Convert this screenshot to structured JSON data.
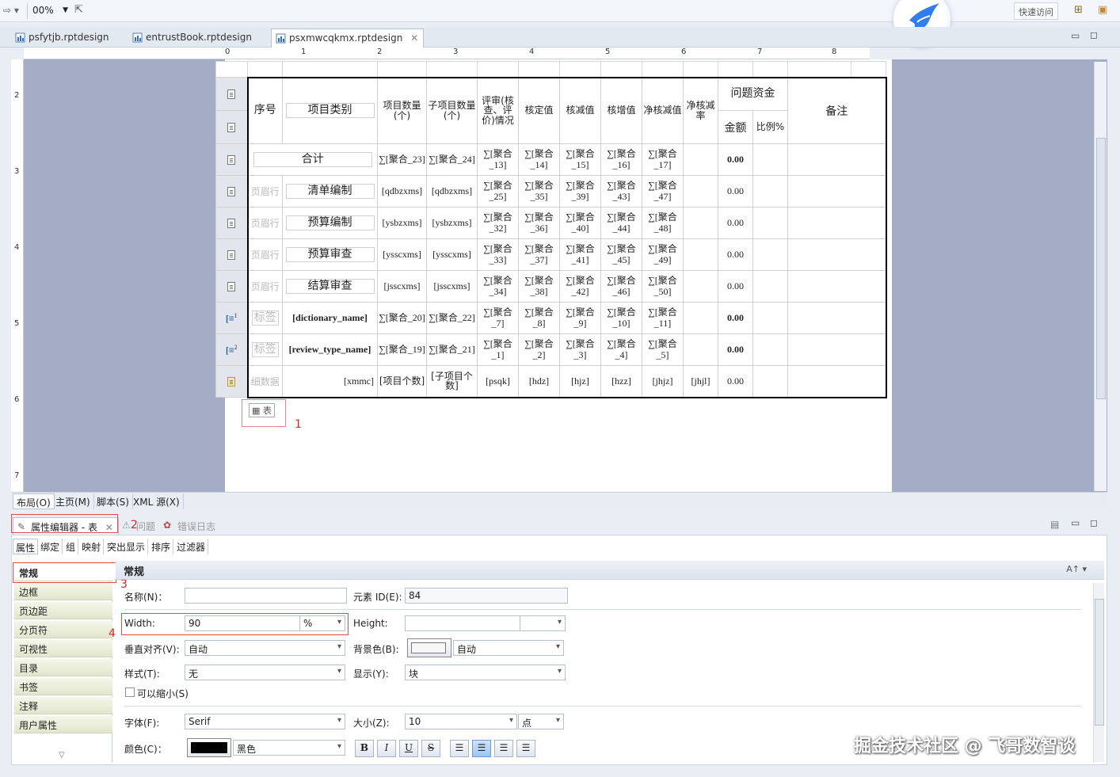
{
  "toolbar": {
    "zoom": "00%",
    "quick_access": "快速访问"
  },
  "tabs": [
    {
      "label": "psfytjb.rptdesign"
    },
    {
      "label": "entrustBook.rptdesign"
    },
    {
      "label": "psxmwcqkmx.rptdesign"
    }
  ],
  "ruler": {
    "h": [
      "0",
      "1",
      "2",
      "3",
      "4",
      "5",
      "6",
      "7",
      "8"
    ],
    "v": [
      "2",
      "3",
      "4",
      "5",
      "6",
      "7"
    ]
  },
  "report": {
    "header": {
      "xh": "序号",
      "xmlb": "项目类别",
      "xmsl": "项目数量(个)",
      "zxmsl": "子项目数量(个)",
      "psqk": "评审(核查、评价)情况",
      "hdz": "核定值",
      "hjz": "核减值",
      "hzz": "核增值",
      "jhjz": "净核减值",
      "jhjl": "净核减率",
      "wtzj": "问题资金",
      "je": "金额",
      "bl": "比例%",
      "bz": "备注"
    },
    "total": {
      "label": "合计",
      "cells": [
        "∑[聚合_23]",
        "∑[聚合_24]",
        "∑[聚合_13]",
        "∑[聚合_14]",
        "∑[聚合_15]",
        "∑[聚合_16]",
        "∑[聚合_17]"
      ],
      "amount": "0.00"
    },
    "rows": [
      {
        "ghost": "页眉行",
        "name": "清单编制",
        "a": "[qdbzxms]",
        "b": "[qdbzxms]",
        "c": [
          "∑[聚合_25]",
          "∑[聚合_35]",
          "∑[聚合_39]",
          "∑[聚合_43]",
          "∑[聚合_47]"
        ],
        "amount": "0.00"
      },
      {
        "ghost": "页眉行",
        "name": "预算编制",
        "a": "[ysbzxms]",
        "b": "[ysbzxms]",
        "c": [
          "∑[聚合_32]",
          "∑[聚合_36]",
          "∑[聚合_40]",
          "∑[聚合_44]",
          "∑[聚合_48]"
        ],
        "amount": "0.00"
      },
      {
        "ghost": "页眉行",
        "name": "预算审查",
        "a": "[ysscxms]",
        "b": "[ysscxms]",
        "c": [
          "∑[聚合_33]",
          "∑[聚合_37]",
          "∑[聚合_41]",
          "∑[聚合_45]",
          "∑[聚合_49]"
        ],
        "amount": "0.00"
      },
      {
        "ghost": "页眉行",
        "name": "结算审查",
        "a": "[jssсxms]",
        "b": "[jssсxms]",
        "c": [
          "∑[聚合_34]",
          "∑[聚合_38]",
          "∑[聚合_42]",
          "∑[聚合_46]",
          "∑[聚合_50]"
        ],
        "amount": "0.00"
      }
    ],
    "groups": [
      {
        "icon_num": "1",
        "ghost": "标签",
        "name": "[dictionary_name]",
        "a": "∑[聚合_20]",
        "b": "∑[聚合_22]",
        "c": [
          "∑[聚合_7]",
          "∑[聚合_8]",
          "∑[聚合_9]",
          "∑[聚合_10]",
          "∑[聚合_11]"
        ],
        "amount": "0.00"
      },
      {
        "icon_num": "2",
        "ghost": "标签",
        "name": "[review_type_name]",
        "a": "∑[聚合_19]",
        "b": "∑[聚合_21]",
        "c": [
          "∑[聚合_1]",
          "∑[聚合_2]",
          "∑[聚合_3]",
          "∑[聚合_4]",
          "∑[聚合_5]"
        ],
        "amount": "0.00"
      }
    ],
    "detail": {
      "ghost": "细数据",
      "name": "[xmmc]",
      "a": "[项目个数]",
      "b": "[子项目个数]",
      "c": [
        "[psqk]",
        "[hdz]",
        "[hjz]",
        "[hzz]",
        "[jhjz]",
        "[jhjl]"
      ],
      "amount": "0.00"
    }
  },
  "table_tag": "表",
  "markers": [
    "1",
    "2",
    "3",
    "4"
  ],
  "bottom_tabs": [
    "布局(O)",
    "主页(M)",
    "脚本(S)",
    "XML 源(X)"
  ],
  "panel_tabs": {
    "property": "属性编辑器 - 表",
    "problems": "问题",
    "errors": "错误日志"
  },
  "sub_tabs": [
    "属性",
    "绑定",
    "组",
    "映射",
    "突出显示",
    "排序",
    "过滤器"
  ],
  "categories": [
    "常规",
    "边框",
    "页边距",
    "分页符",
    "可视性",
    "目录",
    "书签",
    "注释",
    "用户属性"
  ],
  "props": {
    "section": "常规",
    "name_label": "名称(N)：",
    "name_value": "",
    "id_label": "元素 ID(E):",
    "id_value": "84",
    "width_label": "Width:",
    "width_value": "90",
    "width_unit": "%",
    "height_label": "Height:",
    "height_value": "",
    "valign_label": "垂直对齐(V):",
    "valign_value": "自动",
    "bg_label": "背景色(B):",
    "bg_value": "自动",
    "style_label": "样式(T):",
    "style_value": "无",
    "display_label": "显示(Y):",
    "display_value": "块",
    "shrink_label": "可以缩小(S)",
    "font_label": "字体(F):",
    "font_value": "Serif",
    "size_label": "大小(Z):",
    "size_value": "10",
    "size_unit": "点",
    "color_label": "颜色(C)：",
    "color_value": "黑色"
  },
  "format_buttons": [
    "B",
    "I",
    "U",
    "S"
  ],
  "watermark": "掘金技术社区 @ 飞哥数智谈"
}
